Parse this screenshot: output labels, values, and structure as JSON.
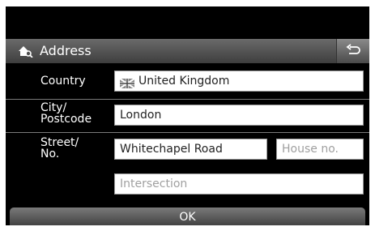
{
  "header": {
    "title": "Address",
    "title_icon": "home-search-icon",
    "back_icon": "back-arrow-icon"
  },
  "form": {
    "country": {
      "label": "Country",
      "value": "United Kingdom",
      "flag_icon": "uk-flag-icon"
    },
    "city": {
      "label_line1": "City/",
      "label_line2": "Postcode",
      "value": "London"
    },
    "street": {
      "label_line1": "Street/",
      "label_line2": "No.",
      "value": "Whitechapel Road",
      "house_placeholder": "House no."
    },
    "intersection": {
      "placeholder": "Intersection"
    }
  },
  "footer": {
    "ok_label": "OK"
  },
  "colors": {
    "background": "#000000",
    "field": "#ffffff",
    "placeholder": "#a0a0a0"
  }
}
